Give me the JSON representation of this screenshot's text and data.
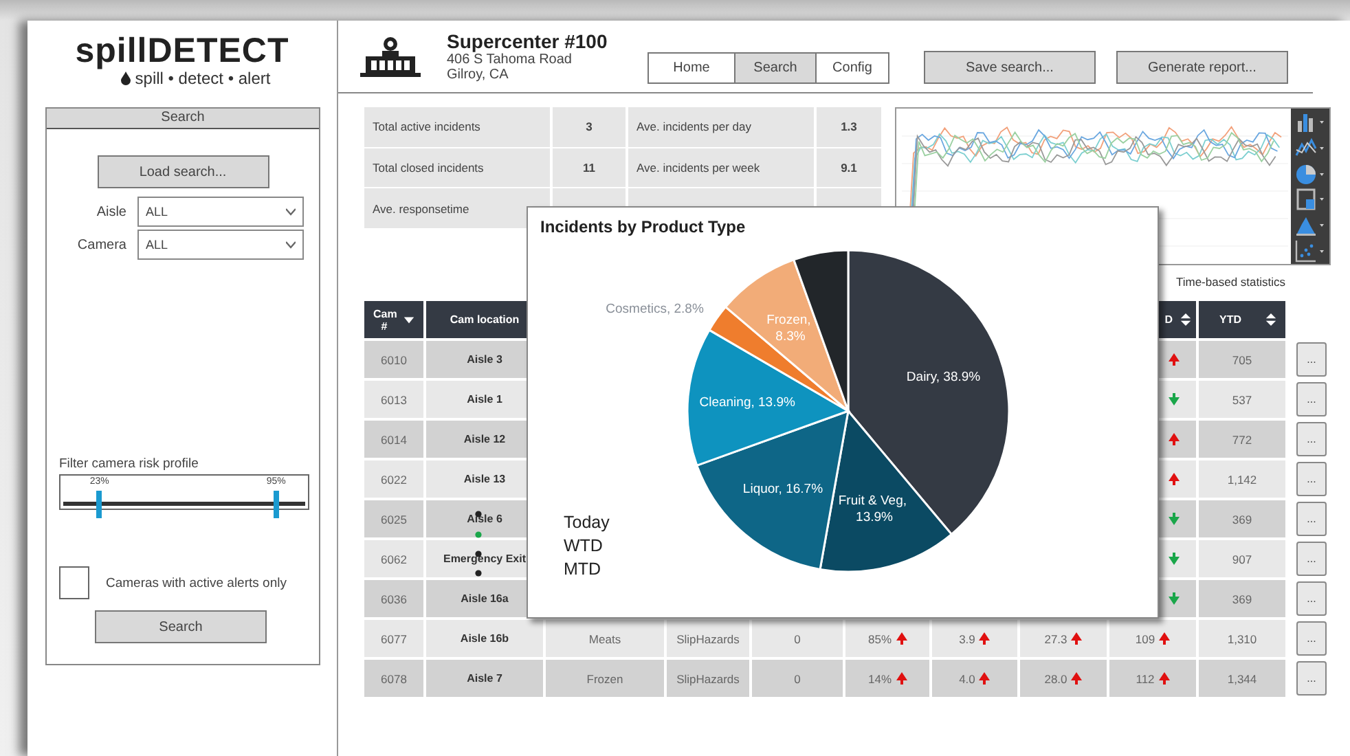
{
  "logo": {
    "name": "spillDETECT",
    "tagline": "spill • detect • alert"
  },
  "search_panel": {
    "title": "Search",
    "load_button": "Load search...",
    "filters": [
      {
        "label": "Aisle",
        "value": "ALL"
      },
      {
        "label": "Camera",
        "value": "ALL"
      }
    ],
    "risk_filter": {
      "label": "Filter camera risk profile",
      "thumbs": [
        {
          "reading": "23%",
          "level": 0.15
        },
        {
          "reading": "95%",
          "level": 0.88
        }
      ]
    },
    "alerts_only": {
      "label": "Cameras with active alerts only",
      "checked": false
    },
    "search_button": "Search"
  },
  "store": {
    "name": "Supercenter #100",
    "address": [
      "406 S Tahoma Road",
      "Gilroy, CA"
    ]
  },
  "tabs": [
    {
      "label": "Home",
      "selected": false
    },
    {
      "label": "Search",
      "selected": true
    },
    {
      "label": "Config",
      "selected": false
    }
  ],
  "actions": [
    "Save search...",
    "Generate report..."
  ],
  "stats": {
    "left": [
      {
        "label": "Total active incidents",
        "value": "3"
      },
      {
        "label": "Total closed incidents",
        "value": "11"
      },
      {
        "label": "Ave. responsetime"
      }
    ],
    "right": [
      {
        "label": "Ave. incidents per day",
        "value": "1.3"
      },
      {
        "label": "Ave. incidents per week",
        "value": "9.1"
      }
    ]
  },
  "time_stats_label": "Time-based statistics",
  "table": {
    "columns": {
      "cam": {
        "label": "Cam #",
        "kind": "dropdown"
      },
      "location": {
        "label": "Cam location"
      },
      "column_9": {
        "label": "D",
        "kind": "sortable"
      },
      "ytd": {
        "label": "YTD",
        "kind": "sortable"
      }
    },
    "rows": [
      {
        "cam": "6010",
        "location": "Aisle 3",
        "cells": [
          null,
          null,
          null,
          null,
          null,
          null,
          {
            "rising": true
          },
          {
            "text": "705"
          }
        ],
        "action": "..."
      },
      {
        "cam": "6013",
        "location": "Aisle 1",
        "cells": [
          null,
          null,
          null,
          null,
          null,
          null,
          {
            "rising": false
          },
          {
            "text": "537"
          }
        ],
        "action": "..."
      },
      {
        "cam": "6014",
        "location": "Aisle 12",
        "cells": [
          null,
          null,
          null,
          null,
          null,
          null,
          {
            "rising": true
          },
          {
            "text": "772"
          }
        ],
        "action": "..."
      },
      {
        "cam": "6022",
        "location": "Aisle 13",
        "cells": [
          null,
          null,
          null,
          null,
          null,
          null,
          {
            "rising": true
          },
          {
            "text": "1,142"
          }
        ],
        "action": "..."
      },
      {
        "cam": "6025",
        "location": "Aisle 6",
        "cells": [
          null,
          null,
          null,
          null,
          null,
          null,
          {
            "rising": false
          },
          {
            "text": "369"
          }
        ],
        "action": "..."
      },
      {
        "cam": "6062",
        "location": "Emergency Exit",
        "cells": [
          null,
          null,
          null,
          null,
          null,
          null,
          {
            "rising": false
          },
          {
            "text": "907"
          }
        ],
        "action": "..."
      },
      {
        "cam": "6036",
        "location": "Aisle 16a",
        "cells": [
          null,
          null,
          null,
          null,
          null,
          null,
          {
            "rising": false
          },
          {
            "text": "369"
          }
        ],
        "action": "..."
      },
      {
        "cam": "6077",
        "location": "Aisle 16b",
        "cells": [
          {
            "text": "Meats"
          },
          {
            "text": "SlipHazards"
          },
          {
            "text": "0"
          },
          {
            "text": "85%",
            "rising": true
          },
          {
            "text": "3.9",
            "rising": true
          },
          {
            "text": "27.3",
            "rising": true
          },
          {
            "text": "109",
            "rising": true
          },
          {
            "text": "1,310"
          }
        ],
        "action": "..."
      },
      {
        "cam": "6078",
        "location": "Aisle 7",
        "cells": [
          {
            "text": "Frozen"
          },
          {
            "text": "SlipHazards"
          },
          {
            "text": "0"
          },
          {
            "text": "14%",
            "rising": true
          },
          {
            "text": "4.0",
            "rising": true
          },
          {
            "text": "28.0",
            "rising": true
          },
          {
            "text": "112",
            "rising": true
          },
          {
            "text": "1,344"
          }
        ],
        "action": "..."
      }
    ]
  },
  "popup": {
    "periods": [
      "Today",
      "WTD",
      "MTD"
    ],
    "chart_data": {
      "type": "pie",
      "title": "Incidents by Product Type",
      "values": [
        38.9,
        13.9,
        16.7,
        13.9,
        2.8,
        8.3,
        5.5
      ],
      "colors": [
        "#343a44",
        "#0b4a63",
        "#0e6687",
        "#0e93bf",
        "#ef7d2d",
        "#f2ac78",
        "#22262a"
      ],
      "value_labels": [
        "Dairy, 38.9%",
        "Fruit & Veg, 13.9%",
        "Liquor, 16.7%",
        "Cleaning, 13.9%",
        "Cosmetics, 2.8%",
        "Frozen, 8.3%",
        null
      ]
    }
  }
}
